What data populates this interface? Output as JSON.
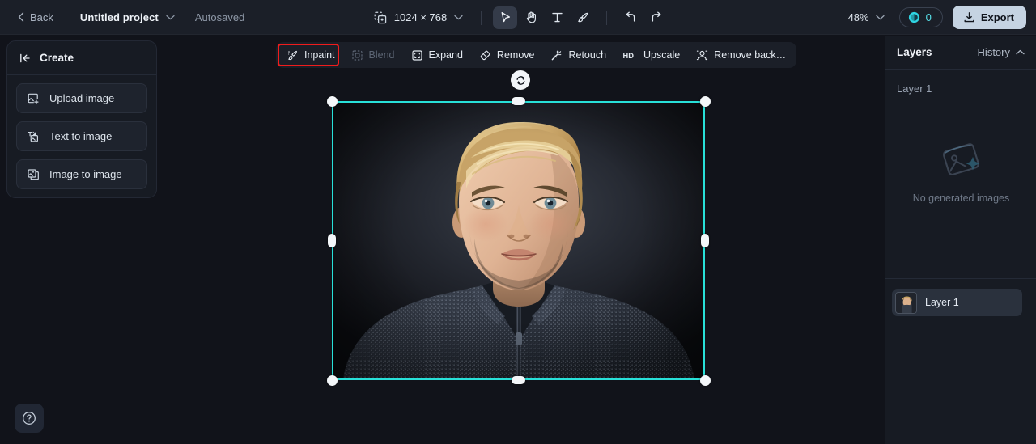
{
  "topbar": {
    "back_label": "Back",
    "project_name": "Untitled project",
    "autosave_status": "Autosaved",
    "canvas_size": "1024 × 768",
    "tools": [
      {
        "name": "select-tool",
        "icon": "cursor-arrow-icon",
        "active": true
      },
      {
        "name": "hand-tool",
        "icon": "hand-icon",
        "active": false
      },
      {
        "name": "text-tool",
        "icon": "text-icon",
        "active": false
      },
      {
        "name": "brush-tool",
        "icon": "brush-icon",
        "active": false
      }
    ],
    "undo_icon": "undo-icon",
    "redo_icon": "redo-icon",
    "zoom_level": "48%",
    "credits_count": "0",
    "export_label": "Export"
  },
  "create_panel": {
    "title": "Create",
    "collapse_icon": "collapse-left-icon",
    "items": [
      {
        "label": "Upload image",
        "icon": "upload-image-icon"
      },
      {
        "label": "Text to image",
        "icon": "text-to-image-icon"
      },
      {
        "label": "Image to image",
        "icon": "image-to-image-icon"
      }
    ]
  },
  "edit_toolbar": {
    "items": [
      {
        "label": "Inpaint",
        "icon": "inpaint-brush-icon",
        "disabled": false,
        "highlighted": true
      },
      {
        "label": "Blend",
        "icon": "blend-icon",
        "disabled": true,
        "highlighted": false
      },
      {
        "label": "Expand",
        "icon": "expand-icon",
        "disabled": false,
        "highlighted": false
      },
      {
        "label": "Remove",
        "icon": "eraser-icon",
        "disabled": false,
        "highlighted": false
      },
      {
        "label": "Retouch",
        "icon": "magic-wand-icon",
        "disabled": false,
        "highlighted": false
      },
      {
        "label": "Upscale",
        "icon": "hd-icon",
        "disabled": false,
        "highlighted": false
      },
      {
        "label": "Remove back…",
        "icon": "remove-background-icon",
        "disabled": false,
        "highlighted": false
      }
    ]
  },
  "canvas": {
    "selection_color": "#28e0d8",
    "rotate_icon": "rotate-icon",
    "image_description": "Portrait photo of a young man with blonde hair wearing a dark knit sweater"
  },
  "right_panel": {
    "title": "Layers",
    "history_label": "History",
    "history_icon": "chevron-up-icon",
    "layer_group_name": "Layer 1",
    "empty_state_text": "No generated images",
    "empty_state_icon": "image-placeholder-icon",
    "layers": [
      {
        "label": "Layer 1",
        "selected": true
      }
    ]
  },
  "help": {
    "icon": "question-mark-icon",
    "label": "Help"
  },
  "colors": {
    "accent_cyan": "#28e0d8",
    "annotation_red": "#f01c1c",
    "export_bg": "#c5d3e2",
    "panel_bg": "#171b23",
    "topbar_bg": "#1b1f28",
    "canvas_bg": "#11131a"
  }
}
